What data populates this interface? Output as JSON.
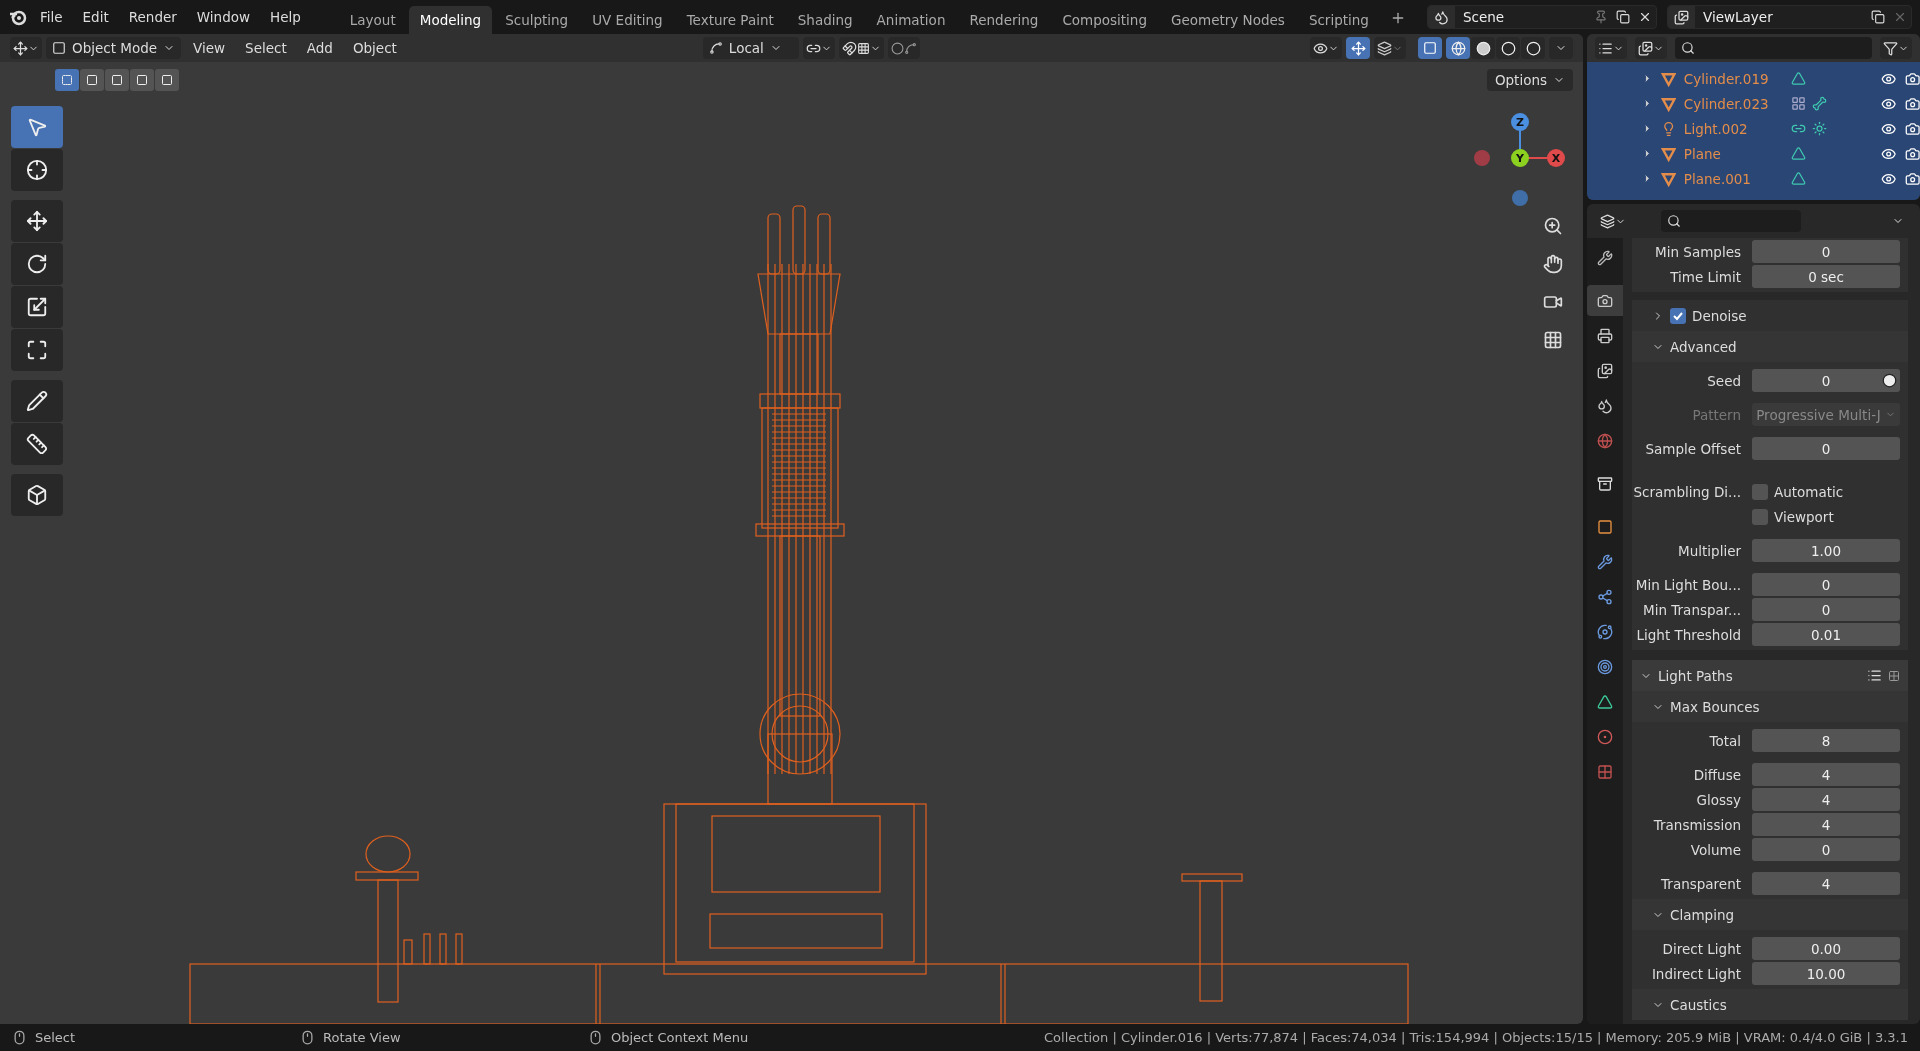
{
  "menu": [
    {
      "label": "File"
    },
    {
      "label": "Edit"
    },
    {
      "label": "Render"
    },
    {
      "label": "Window"
    },
    {
      "label": "Help"
    }
  ],
  "workspaces": [
    {
      "label": "Layout",
      "selected": false
    },
    {
      "label": "Modeling",
      "selected": true
    },
    {
      "label": "Sculpting",
      "selected": false
    },
    {
      "label": "UV Editing",
      "selected": false
    },
    {
      "label": "Texture Paint",
      "selected": false
    },
    {
      "label": "Shading",
      "selected": false
    },
    {
      "label": "Animation",
      "selected": false
    },
    {
      "label": "Rendering",
      "selected": false
    },
    {
      "label": "Compositing",
      "selected": false
    },
    {
      "label": "Geometry Nodes",
      "selected": false
    },
    {
      "label": "Scripting",
      "selected": false
    }
  ],
  "scene": "Scene",
  "view_layer": "ViewLayer",
  "viewport_header": {
    "mode": "Object Mode",
    "menus": [
      "View",
      "Select",
      "Add",
      "Object"
    ],
    "orientation": "Local",
    "options": "Options"
  },
  "select_modes": [
    {
      "selected": true
    },
    {
      "selected": false
    },
    {
      "selected": false
    },
    {
      "selected": false
    },
    {
      "selected": false
    }
  ],
  "shading": [
    {
      "selected": true
    },
    {
      "selected": false
    },
    {
      "selected": false
    },
    {
      "selected": false
    }
  ],
  "tools": [
    {
      "kind": "select",
      "selected": true
    },
    {
      "kind": "cursor",
      "selected": false
    },
    {
      "kind": "move",
      "selected": false
    },
    {
      "kind": "rotate",
      "selected": false
    },
    {
      "kind": "scale",
      "selected": false
    },
    {
      "kind": "transform",
      "selected": false
    },
    {
      "kind": "annotate",
      "selected": false
    },
    {
      "kind": "measure",
      "selected": false
    },
    {
      "kind": "add-cube",
      "selected": false
    }
  ],
  "gizmo_axes": [
    {
      "label": "Z"
    },
    {
      "label": "Y"
    },
    {
      "label": "X"
    }
  ],
  "outliner": [
    {
      "name": "Cylinder.019",
      "kind": "mesh",
      "extras": [
        {
          "kind": "mesh-data"
        }
      ]
    },
    {
      "name": "Cylinder.023",
      "kind": "mesh",
      "extras": [
        {
          "kind": "modifier"
        },
        {
          "kind": "bone"
        }
      ]
    },
    {
      "name": "Light.002",
      "kind": "light",
      "extras": [
        {
          "kind": "constraint"
        },
        {
          "kind": "sun"
        }
      ]
    },
    {
      "name": "Plane",
      "kind": "mesh",
      "extras": [
        {
          "kind": "mesh-data"
        }
      ]
    },
    {
      "name": "Plane.001",
      "kind": "mesh",
      "extras": [
        {
          "kind": "mesh-data"
        }
      ]
    }
  ],
  "property_tabs": [
    {
      "kind": "tool",
      "selected": false
    },
    {
      "kind": "render",
      "selected": true
    },
    {
      "kind": "output",
      "selected": false
    },
    {
      "kind": "view-layer",
      "selected": false
    },
    {
      "kind": "scene",
      "selected": false
    },
    {
      "kind": "world",
      "selected": false
    },
    {
      "kind": "collection",
      "selected": false
    },
    {
      "kind": "object",
      "selected": false
    },
    {
      "kind": "modifiers",
      "selected": false
    },
    {
      "kind": "particles",
      "selected": false
    },
    {
      "kind": "physics",
      "selected": false
    },
    {
      "kind": "constraints",
      "selected": false
    },
    {
      "kind": "data",
      "selected": false
    },
    {
      "kind": "material",
      "selected": false
    },
    {
      "kind": "texture",
      "selected": false
    }
  ],
  "properties": [
    {
      "kind": "fields",
      "rows": [
        {
          "label": "Min Samples",
          "value": "0"
        },
        {
          "label": "Time Limit",
          "value": "0 sec"
        }
      ]
    },
    {
      "kind": "check-header",
      "label": "Denoise",
      "checked": true,
      "expanded": false
    },
    {
      "kind": "subpanel",
      "label": "Advanced",
      "expanded": true
    },
    {
      "kind": "fields",
      "rows": [
        {
          "label": "Seed",
          "value": "0",
          "kind": "seed"
        }
      ]
    },
    {
      "kind": "fields",
      "rows": [
        {
          "label": "Pattern",
          "value": "Progressive Multi-J",
          "kind": "dropdown",
          "disabled": true
        }
      ]
    },
    {
      "kind": "fields",
      "rows": [
        {
          "label": "Sample Offset",
          "value": "0"
        }
      ]
    },
    {
      "kind": "checks",
      "label": "Scrambling Di...",
      "options": [
        {
          "label": "Automatic",
          "checked": false
        },
        {
          "label": "Viewport",
          "checked": false
        }
      ]
    },
    {
      "kind": "fields",
      "rows": [
        {
          "label": "Multiplier",
          "value": "1.00"
        }
      ]
    },
    {
      "kind": "fields",
      "rows": [
        {
          "label": "Min Light Bou...",
          "value": "0"
        },
        {
          "label": "Min Transpar...",
          "value": "0"
        },
        {
          "label": "Light Threshold",
          "value": "0.01"
        }
      ]
    },
    {
      "kind": "panel",
      "label": "Light Paths",
      "expanded": true
    },
    {
      "kind": "subpanel",
      "label": "Max Bounces",
      "expanded": true
    },
    {
      "kind": "fields",
      "rows": [
        {
          "label": "Total",
          "value": "8"
        }
      ]
    },
    {
      "kind": "fields",
      "rows": [
        {
          "label": "Diffuse",
          "value": "4"
        },
        {
          "label": "Glossy",
          "value": "4"
        },
        {
          "label": "Transmission",
          "value": "4"
        },
        {
          "label": "Volume",
          "value": "0"
        }
      ]
    },
    {
      "kind": "fields",
      "rows": [
        {
          "label": "Transparent",
          "value": "4"
        }
      ]
    },
    {
      "kind": "subpanel",
      "label": "Clamping",
      "expanded": true
    },
    {
      "kind": "fields",
      "rows": [
        {
          "label": "Direct Light",
          "value": "0.00"
        },
        {
          "label": "Indirect Light",
          "value": "10.00"
        }
      ]
    },
    {
      "kind": "subpanel",
      "label": "Caustics",
      "expanded": true
    }
  ],
  "status_bar": {
    "hints": [
      {
        "label": "Select"
      },
      {
        "label": "Rotate View"
      },
      {
        "label": "Object Context Menu"
      }
    ],
    "stats": "Collection | Cylinder.016 | Verts:77,874 | Faces:74,034 | Tris:154,994 | Objects:15/15 | Memory: 205.9 MiB | VRAM: 0.4/4.0 GiB | 3.3.1"
  }
}
